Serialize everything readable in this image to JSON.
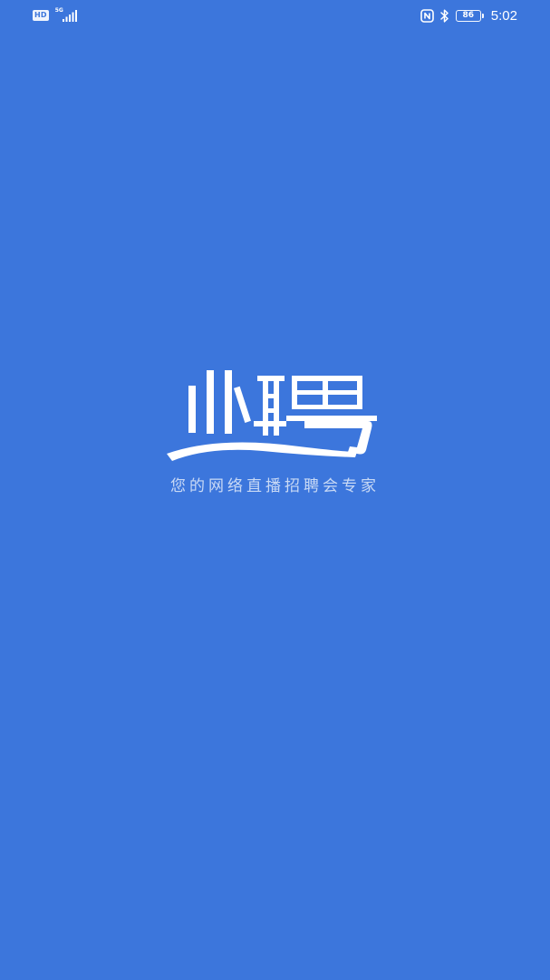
{
  "status_bar": {
    "hd_label": "HD",
    "network_label": "5G",
    "battery_level": "86",
    "time": "5:02"
  },
  "splash": {
    "logo_text": "业聘",
    "tagline": "您的网络直播招聘会专家"
  },
  "colors": {
    "background": "#3c76dc",
    "foreground": "#ffffff"
  }
}
